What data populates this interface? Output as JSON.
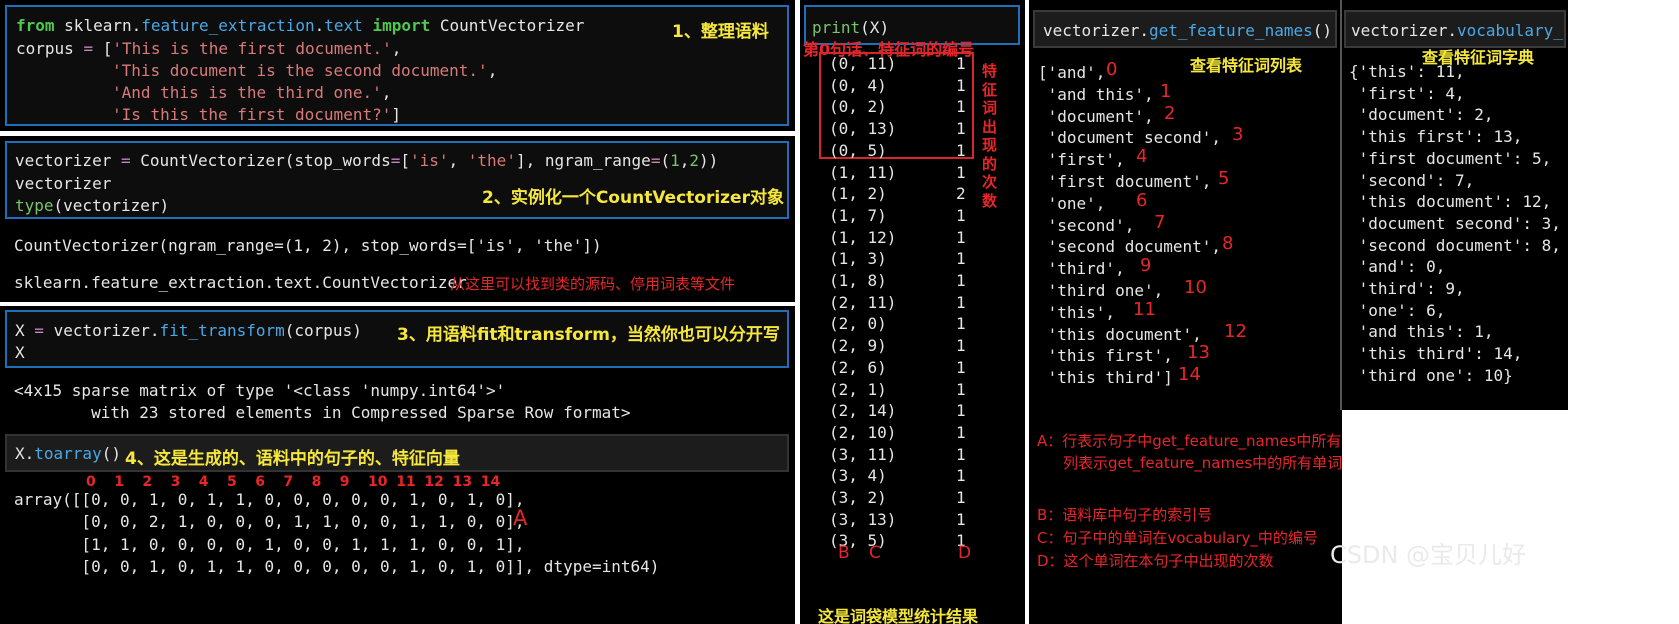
{
  "panel1": {
    "code": {
      "kw_from": "from",
      "module": "sklearn.",
      "module_fe": "feature_extraction",
      "module_dot": ".",
      "module_text": "text",
      "kw_import": "import",
      "cls": "CountVectorizer",
      "corpus_var": "corpus",
      "eq": "=",
      "open": "[",
      "docs": [
        "'This is the first document.'",
        "'This document is the second document.'",
        "'And this is the third one.'",
        "'Is this the first document?'"
      ],
      "comma": ",",
      "close": "]"
    },
    "note": "1、整理语料"
  },
  "panel2": {
    "code_line1_pre": "vectorizer ",
    "code_line1_eq": "=",
    "code_line1_call": " CountVectorizer(stop_words",
    "code_line1_eq2": "=",
    "code_line1_list_open": "[",
    "code_line1_s1": "'is'",
    "code_line1_sep": ", ",
    "code_line1_s2": "'the'",
    "code_line1_mid": "], ngram_range",
    "code_line1_eq3": "=",
    "code_line1_tuple_open": "(",
    "code_line1_n1": "1",
    "code_line1_tcomma": ",",
    "code_line1_n2": "2",
    "code_line1_end": "))",
    "code_line2": "vectorizer",
    "code_line3_fn": "type",
    "code_line3_rest": "(vectorizer)",
    "note": "2、实例化一个CountVectorizer对象",
    "out1": "CountVectorizer(ngram_range=(1, 2), stop_words=['is', 'the'])",
    "out2": "sklearn.feature_extraction.text.CountVectorizer",
    "note2": "从这里可以找到类的源码、停用词表等文件"
  },
  "panel3": {
    "code_x": "X",
    "code_eq": "=",
    "code_obj": "vectorizer.",
    "code_fn": "fit_transform",
    "code_args": "(corpus)",
    "code_line2": "X",
    "note": "3、用语料fit和transform，当然你也可以分开写",
    "out1": "<4x15 sparse matrix of type '<class 'numpy.int64'>'",
    "out2": "        with 23 stored elements in Compressed Sparse Row format>",
    "toarray_obj": "X.",
    "toarray_fn": "toarray",
    "toarray_paren": "()",
    "note2": "4、这是生成的、语料中的句子的、特征向量",
    "indices": [
      "0",
      "1",
      "2",
      "3",
      "4",
      "5",
      "6",
      "7",
      "8",
      "9",
      "10",
      "11",
      "12",
      "13",
      "14"
    ],
    "array_lines": [
      "array([[0, 0, 1, 0, 1, 1, 0, 0, 0, 0, 0, 1, 0, 1, 0],",
      "       [0, 0, 2, 1, 0, 0, 0, 1, 1, 0, 0, 1, 1, 0, 0],",
      "       [1, 1, 0, 0, 0, 0, 1, 0, 0, 1, 1, 1, 0, 0, 1],",
      "       [0, 0, 1, 0, 1, 1, 0, 0, 0, 0, 0, 1, 0, 1, 0]], dtype=int64)"
    ],
    "label_a": "A"
  },
  "panel4": {
    "code_fn": "print",
    "code_rest": "(X)",
    "header_note": "第0句话、特征词的编号",
    "rows": [
      {
        "idx": "(0, 11)",
        "count": "1"
      },
      {
        "idx": "(0, 4)",
        "count": "1"
      },
      {
        "idx": "(0, 2)",
        "count": "1"
      },
      {
        "idx": "(0, 13)",
        "count": "1"
      },
      {
        "idx": "(0, 5)",
        "count": "1"
      },
      {
        "idx": "(1, 11)",
        "count": "1"
      },
      {
        "idx": "(1, 2)",
        "count": "2"
      },
      {
        "idx": "(1, 7)",
        "count": "1"
      },
      {
        "idx": "(1, 12)",
        "count": "1"
      },
      {
        "idx": "(1, 3)",
        "count": "1"
      },
      {
        "idx": "(1, 8)",
        "count": "1"
      },
      {
        "idx": "(2, 11)",
        "count": "1"
      },
      {
        "idx": "(2, 0)",
        "count": "1"
      },
      {
        "idx": "(2, 9)",
        "count": "1"
      },
      {
        "idx": "(2, 6)",
        "count": "1"
      },
      {
        "idx": "(2, 1)",
        "count": "1"
      },
      {
        "idx": "(2, 14)",
        "count": "1"
      },
      {
        "idx": "(2, 10)",
        "count": "1"
      },
      {
        "idx": "(3, 11)",
        "count": "1"
      },
      {
        "idx": "(3, 4)",
        "count": "1"
      },
      {
        "idx": "(3, 2)",
        "count": "1"
      },
      {
        "idx": "(3, 13)",
        "count": "1"
      },
      {
        "idx": "(3, 5)",
        "count": "1"
      }
    ],
    "side_note_chars": [
      "特",
      "征",
      "词",
      "出",
      "现",
      "的",
      "次",
      "数"
    ],
    "label_b": "B",
    "label_c": "C",
    "label_d": "D",
    "footer_note": "这是词袋模型统计结果"
  },
  "panel5": {
    "code_obj": "vectorizer.",
    "code_fn": "get_feature_names",
    "code_paren": "()",
    "note": "查看特征词列表",
    "items": [
      {
        "text": "['and',",
        "num": "0"
      },
      {
        "text": " 'and this',",
        "num": "1"
      },
      {
        "text": " 'document',",
        "num": "2"
      },
      {
        "text": " 'document second',",
        "num": "3"
      },
      {
        "text": " 'first',",
        "num": "4"
      },
      {
        "text": " 'first document',",
        "num": "5"
      },
      {
        "text": " 'one',",
        "num": "6"
      },
      {
        "text": " 'second',",
        "num": "7"
      },
      {
        "text": " 'second document',",
        "num": "8"
      },
      {
        "text": " 'third',",
        "num": "9"
      },
      {
        "text": " 'third one',",
        "num": "10"
      },
      {
        "text": " 'this',",
        "num": "11"
      },
      {
        "text": " 'this document',",
        "num": "12"
      },
      {
        "text": " 'this first',",
        "num": "13"
      },
      {
        "text": " 'this third']",
        "num": "14"
      }
    ],
    "explain_a1": "A：行表示句子中get_feature_names中所有单词出现的次数",
    "explain_a2": "列表示get_feature_names中的所有单词",
    "explain_b": "B：语料库中句子的索引号",
    "explain_c": "C：句子中的单词在vocabulary_中的编号",
    "explain_d": "D：这个单词在本句子中出现的次数"
  },
  "panel6": {
    "code_obj": "vectorizer.",
    "code_fn": "vocabulary_",
    "note": "查看特征词字典",
    "lines": [
      "{'this': 11,",
      " 'first': 4,",
      " 'document': 2,",
      " 'this first': 13,",
      " 'first document': 5,",
      " 'second': 7,",
      " 'this document': 12,",
      " 'document second': 3,",
      " 'second document': 8,",
      " 'and': 0,",
      " 'third': 9,",
      " 'one': 6,",
      " 'and this': 1,",
      " 'this third': 14,",
      " 'third one': 10}"
    ]
  },
  "watermark": "CSDN @宝贝儿好",
  "colors": {
    "background": "#000000",
    "cell_border": "#1f6fb8",
    "annotation_yellow": "#f5e73b",
    "annotation_red": "#e8262a",
    "keyword_green": "#4ec94e",
    "function_blue": "#4aa8e6",
    "string_red": "#d97a7a"
  }
}
